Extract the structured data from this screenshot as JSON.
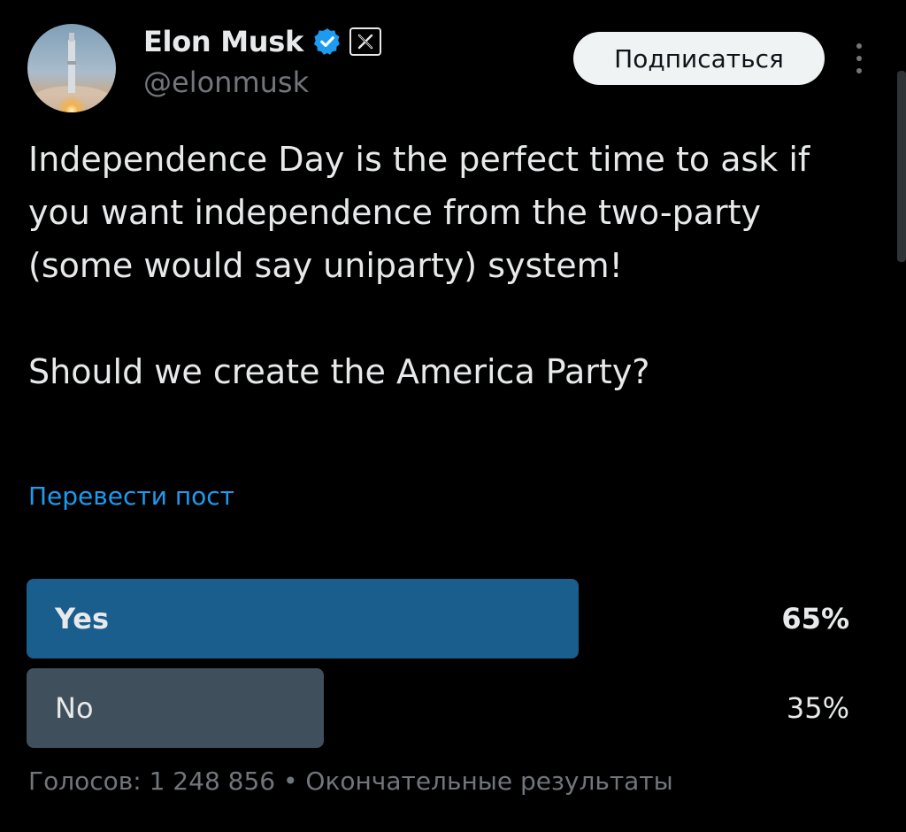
{
  "author": {
    "display_name": "Elon Musk",
    "handle": "@elonmusk",
    "verified_icon": "verified-badge-icon",
    "affiliation_icon": "x-logo-icon",
    "avatar": "avatar-rocket-launch-image"
  },
  "header": {
    "follow_label": "Подписаться",
    "more_icon": "more-vertical-icon"
  },
  "tweet": {
    "text": "Independence Day is the perfect time to ask if you want independence from the two-party (some would say uniparty) system!\n\nShould we create the America Party?",
    "translate_label": "Перевести пост"
  },
  "poll": {
    "options": [
      {
        "label": "Yes",
        "percent_label": "65%",
        "percent": 65,
        "color": "#1a5e8e",
        "winner": true
      },
      {
        "label": "No",
        "percent_label": "35%",
        "percent": 35,
        "color": "#3f4f5c",
        "winner": false
      }
    ],
    "footer": "Голосов: 1 248 856 • Окончательные результаты"
  },
  "colors": {
    "background": "#000000",
    "text": "#e7e9ea",
    "secondary": "#71767b",
    "link": "#1d9bf0",
    "verified": "#1d9bf0"
  },
  "chart_data": {
    "type": "bar",
    "categories": [
      "Yes",
      "No"
    ],
    "values": [
      65,
      35
    ],
    "unit": "%",
    "title": "",
    "xlabel": "",
    "ylabel": "",
    "ylim": [
      0,
      100
    ],
    "grid": false,
    "legend": "none"
  }
}
